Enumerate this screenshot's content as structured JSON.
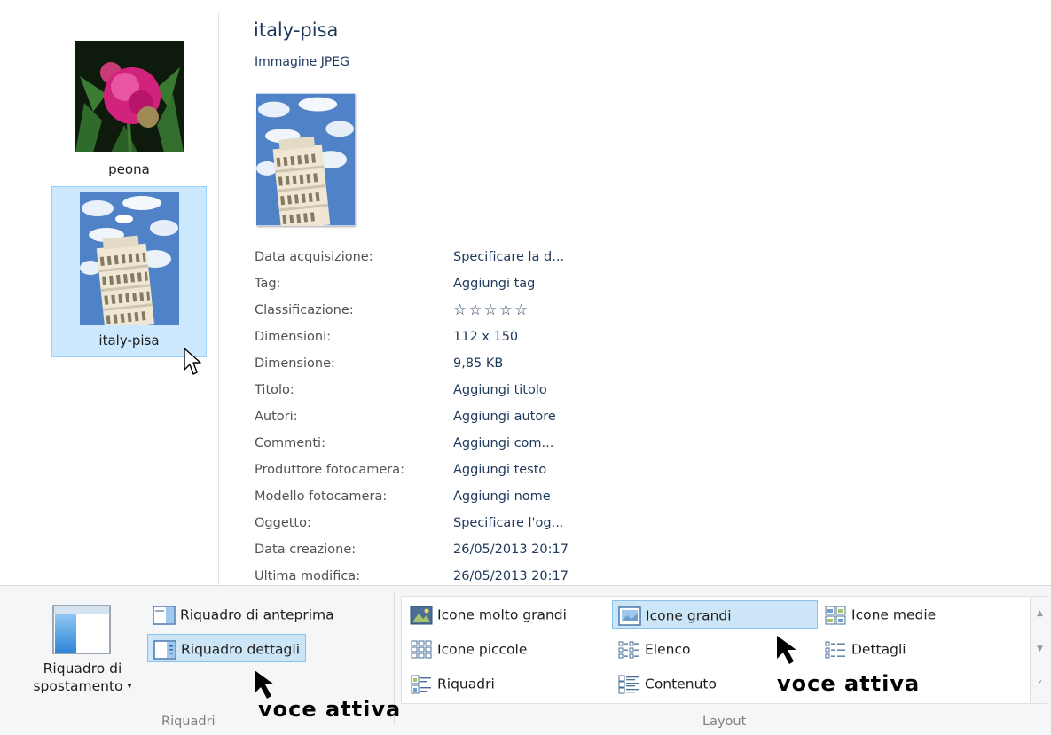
{
  "files": [
    {
      "name": "peona",
      "selected": false
    },
    {
      "name": "italy-pisa",
      "selected": true
    }
  ],
  "details": {
    "name": "italy-pisa",
    "type": "Immagine JPEG",
    "properties": [
      {
        "key": "Data acquisizione:",
        "value": "Specificare la d..."
      },
      {
        "key": "Tag:",
        "value": "Aggiungi tag"
      },
      {
        "key": "Classificazione:",
        "value": "☆☆☆☆☆"
      },
      {
        "key": "Dimensioni:",
        "value": "112 x 150"
      },
      {
        "key": "Dimensione:",
        "value": "9,85 KB"
      },
      {
        "key": "Titolo:",
        "value": "Aggiungi titolo"
      },
      {
        "key": "Autori:",
        "value": "Aggiungi autore"
      },
      {
        "key": "Commenti:",
        "value": "Aggiungi com..."
      },
      {
        "key": "Produttore fotocamera:",
        "value": "Aggiungi testo"
      },
      {
        "key": "Modello fotocamera:",
        "value": "Aggiungi nome"
      },
      {
        "key": "Oggetto:",
        "value": "Specificare l'og..."
      },
      {
        "key": "Data creazione:",
        "value": "26/05/2013 20:17"
      },
      {
        "key": "Ultima modifica:",
        "value": "26/05/2013 20:17"
      }
    ]
  },
  "ribbon": {
    "panes_group": {
      "label": "Riquadri",
      "navigation_pane": {
        "line1": "Riquadro di",
        "line2": "spostamento",
        "arrow": "▾"
      },
      "preview_pane": "Riquadro di anteprima",
      "details_pane": "Riquadro dettagli"
    },
    "layout_group": {
      "label": "Layout",
      "items": {
        "extra_large": "Icone molto grandi",
        "large": "Icone grandi",
        "medium": "Icone medie",
        "small": "Icone piccole",
        "list": "Elenco",
        "details": "Dettagli",
        "tiles": "Riquadri",
        "content": "Contenuto"
      },
      "active": "Icone grandi"
    },
    "scroll": {
      "up": "▲",
      "down": "▼",
      "more": "⩡"
    }
  },
  "annotations": {
    "panes": "voce attiva",
    "layout": "voce attiva"
  },
  "colors": {
    "selection_fill": "#cce8ff",
    "selection_border": "#99d1ff",
    "ribbon_selected_fill": "#cde6f7",
    "ribbon_selected_border": "#88c2ea",
    "value_text": "#1e395b"
  }
}
